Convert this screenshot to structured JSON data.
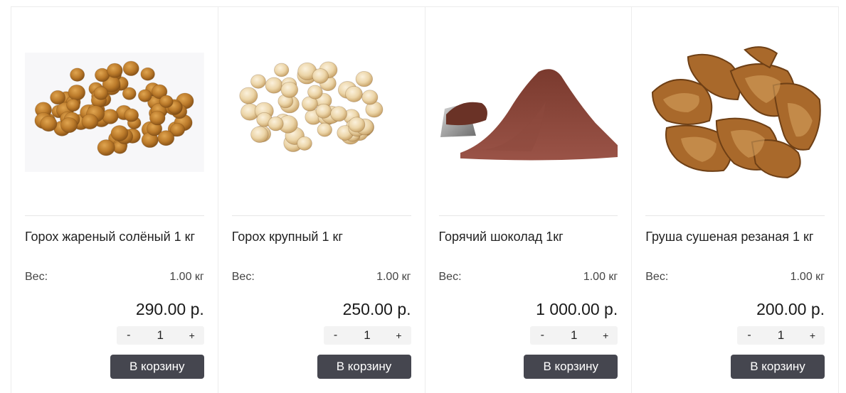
{
  "products": [
    {
      "title": "Горох жареный солёный 1 кг",
      "weight_label": "Вес:",
      "weight_value": "1.00 кг",
      "price": "290.00 р.",
      "qty_minus": "-",
      "qty": "1",
      "qty_plus": "+",
      "cart_label": "В корзину",
      "image": "roasted-chickpeas-image"
    },
    {
      "title": "Горох крупный 1 кг",
      "weight_label": "Вес:",
      "weight_value": "1.00 кг",
      "price": "250.00 р.",
      "qty_minus": "-",
      "qty": "1",
      "qty_plus": "+",
      "cart_label": "В корзину",
      "image": "chickpeas-image"
    },
    {
      "title": "Горячий шоколад 1кг",
      "weight_label": "Вес:",
      "weight_value": "1.00 кг",
      "price": "1 000.00 р.",
      "qty_minus": "-",
      "qty": "1",
      "qty_plus": "+",
      "cart_label": "В корзину",
      "image": "cocoa-powder-image"
    },
    {
      "title": "Груша сушеная резаная 1 кг",
      "weight_label": "Вес:",
      "weight_value": "1.00 кг",
      "price": "200.00 р.",
      "qty_minus": "-",
      "qty": "1",
      "qty_plus": "+",
      "cart_label": "В корзину",
      "image": "dried-pear-image"
    }
  ],
  "colors": {
    "button_bg": "#45464f",
    "stepper_bg": "#f3f3f3",
    "border": "#ececec"
  }
}
